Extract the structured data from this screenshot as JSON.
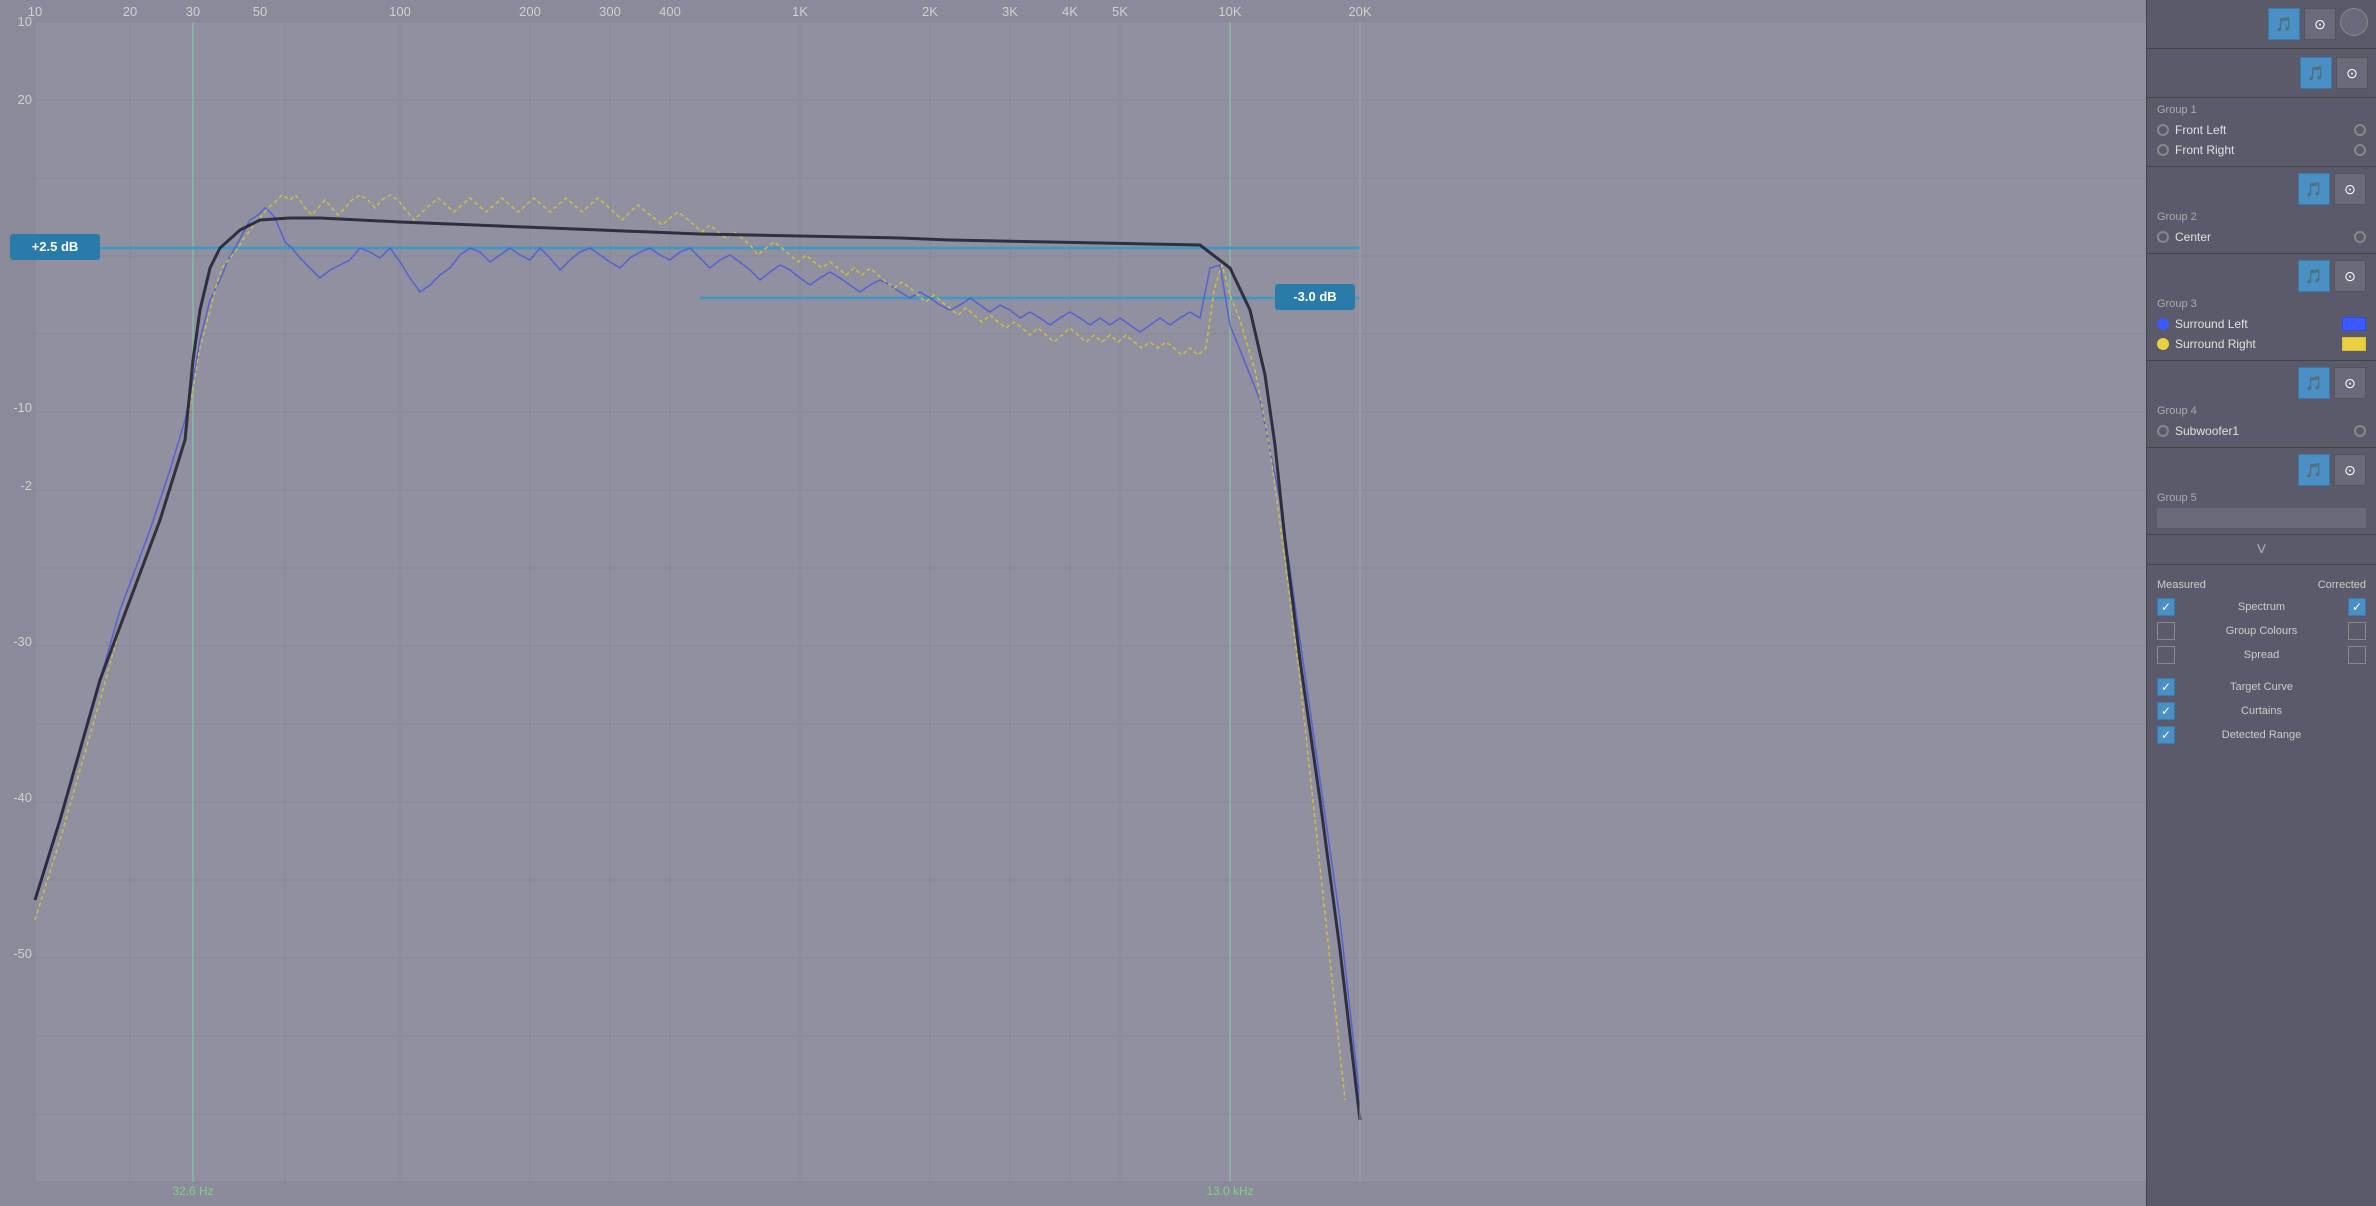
{
  "chart": {
    "freq_labels": [
      "10",
      "20",
      "30",
      "100",
      "200",
      "300",
      "400",
      "1K",
      "2K",
      "3K",
      "4K",
      "5K",
      "10K",
      "20K"
    ],
    "y_labels": [
      "10",
      "20",
      "-10",
      "-2",
      "-30",
      "-40",
      "-50"
    ],
    "db_marker_left": "+2.5 dB",
    "db_marker_right": "-3.0 dB",
    "curtain_left": "32.6 Hz",
    "curtain_right": "13.0 kHz"
  },
  "panel": {
    "group1": {
      "title": "Group 1",
      "channels": [
        {
          "label": "Front Left",
          "color": "empty"
        },
        {
          "label": "Front Right",
          "color": "empty"
        }
      ]
    },
    "group2": {
      "title": "Group 2",
      "channels": [
        {
          "label": "Center",
          "color": "empty"
        }
      ]
    },
    "group3": {
      "title": "Group 3",
      "channels": [
        {
          "label": "Surround Left",
          "color": "blue"
        },
        {
          "label": "Surround Right",
          "color": "yellow"
        }
      ]
    },
    "group4": {
      "title": "Group 4",
      "channels": [
        {
          "label": "Subwoofer1",
          "color": "empty"
        }
      ]
    },
    "group5": {
      "title": "Group 5",
      "channels": []
    }
  },
  "options": {
    "measured_label": "Measured",
    "corrected_label": "Corrected",
    "spectrum_label": "Spectrum",
    "group_colours_label": "Group Colours",
    "spread_label": "Spread",
    "target_curve_label": "Target Curve",
    "curtains_label": "Curtains",
    "detected_range_label": "Detected Range",
    "spectrum_checked_left": true,
    "spectrum_checked_right": true,
    "group_colours_left": false,
    "group_colours_right": false,
    "spread_left": false,
    "spread_right": false,
    "target_curve_checked": true,
    "curtains_checked": true,
    "detected_range_checked": true
  }
}
